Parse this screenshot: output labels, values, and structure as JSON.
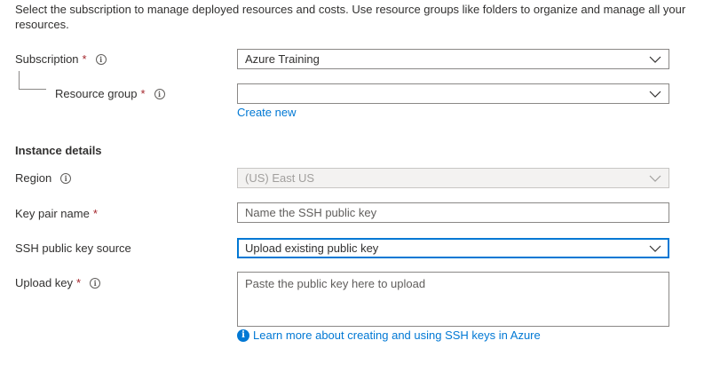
{
  "intro": "Select the subscription to manage deployed resources and costs. Use resource groups like folders to organize and manage all your resources.",
  "subscription": {
    "label": "Subscription",
    "required": "*",
    "value": "Azure Training"
  },
  "resource_group": {
    "label": "Resource group",
    "required": "*",
    "value": "",
    "create_new": "Create new"
  },
  "instance_details": {
    "title": "Instance details"
  },
  "region": {
    "label": "Region",
    "value": "(US) East US"
  },
  "key_pair_name": {
    "label": "Key pair name",
    "required": "*",
    "placeholder": "Name the SSH public key"
  },
  "ssh_source": {
    "label": "SSH public key source",
    "value": "Upload existing public key"
  },
  "upload_key": {
    "label": "Upload key",
    "required": "*",
    "placeholder": "Paste the public key here to upload"
  },
  "learn_more": "Learn more about creating and using SSH keys in Azure",
  "colors": {
    "accent": "#0078d4",
    "required": "#a4262c",
    "border": "#8a8886"
  }
}
